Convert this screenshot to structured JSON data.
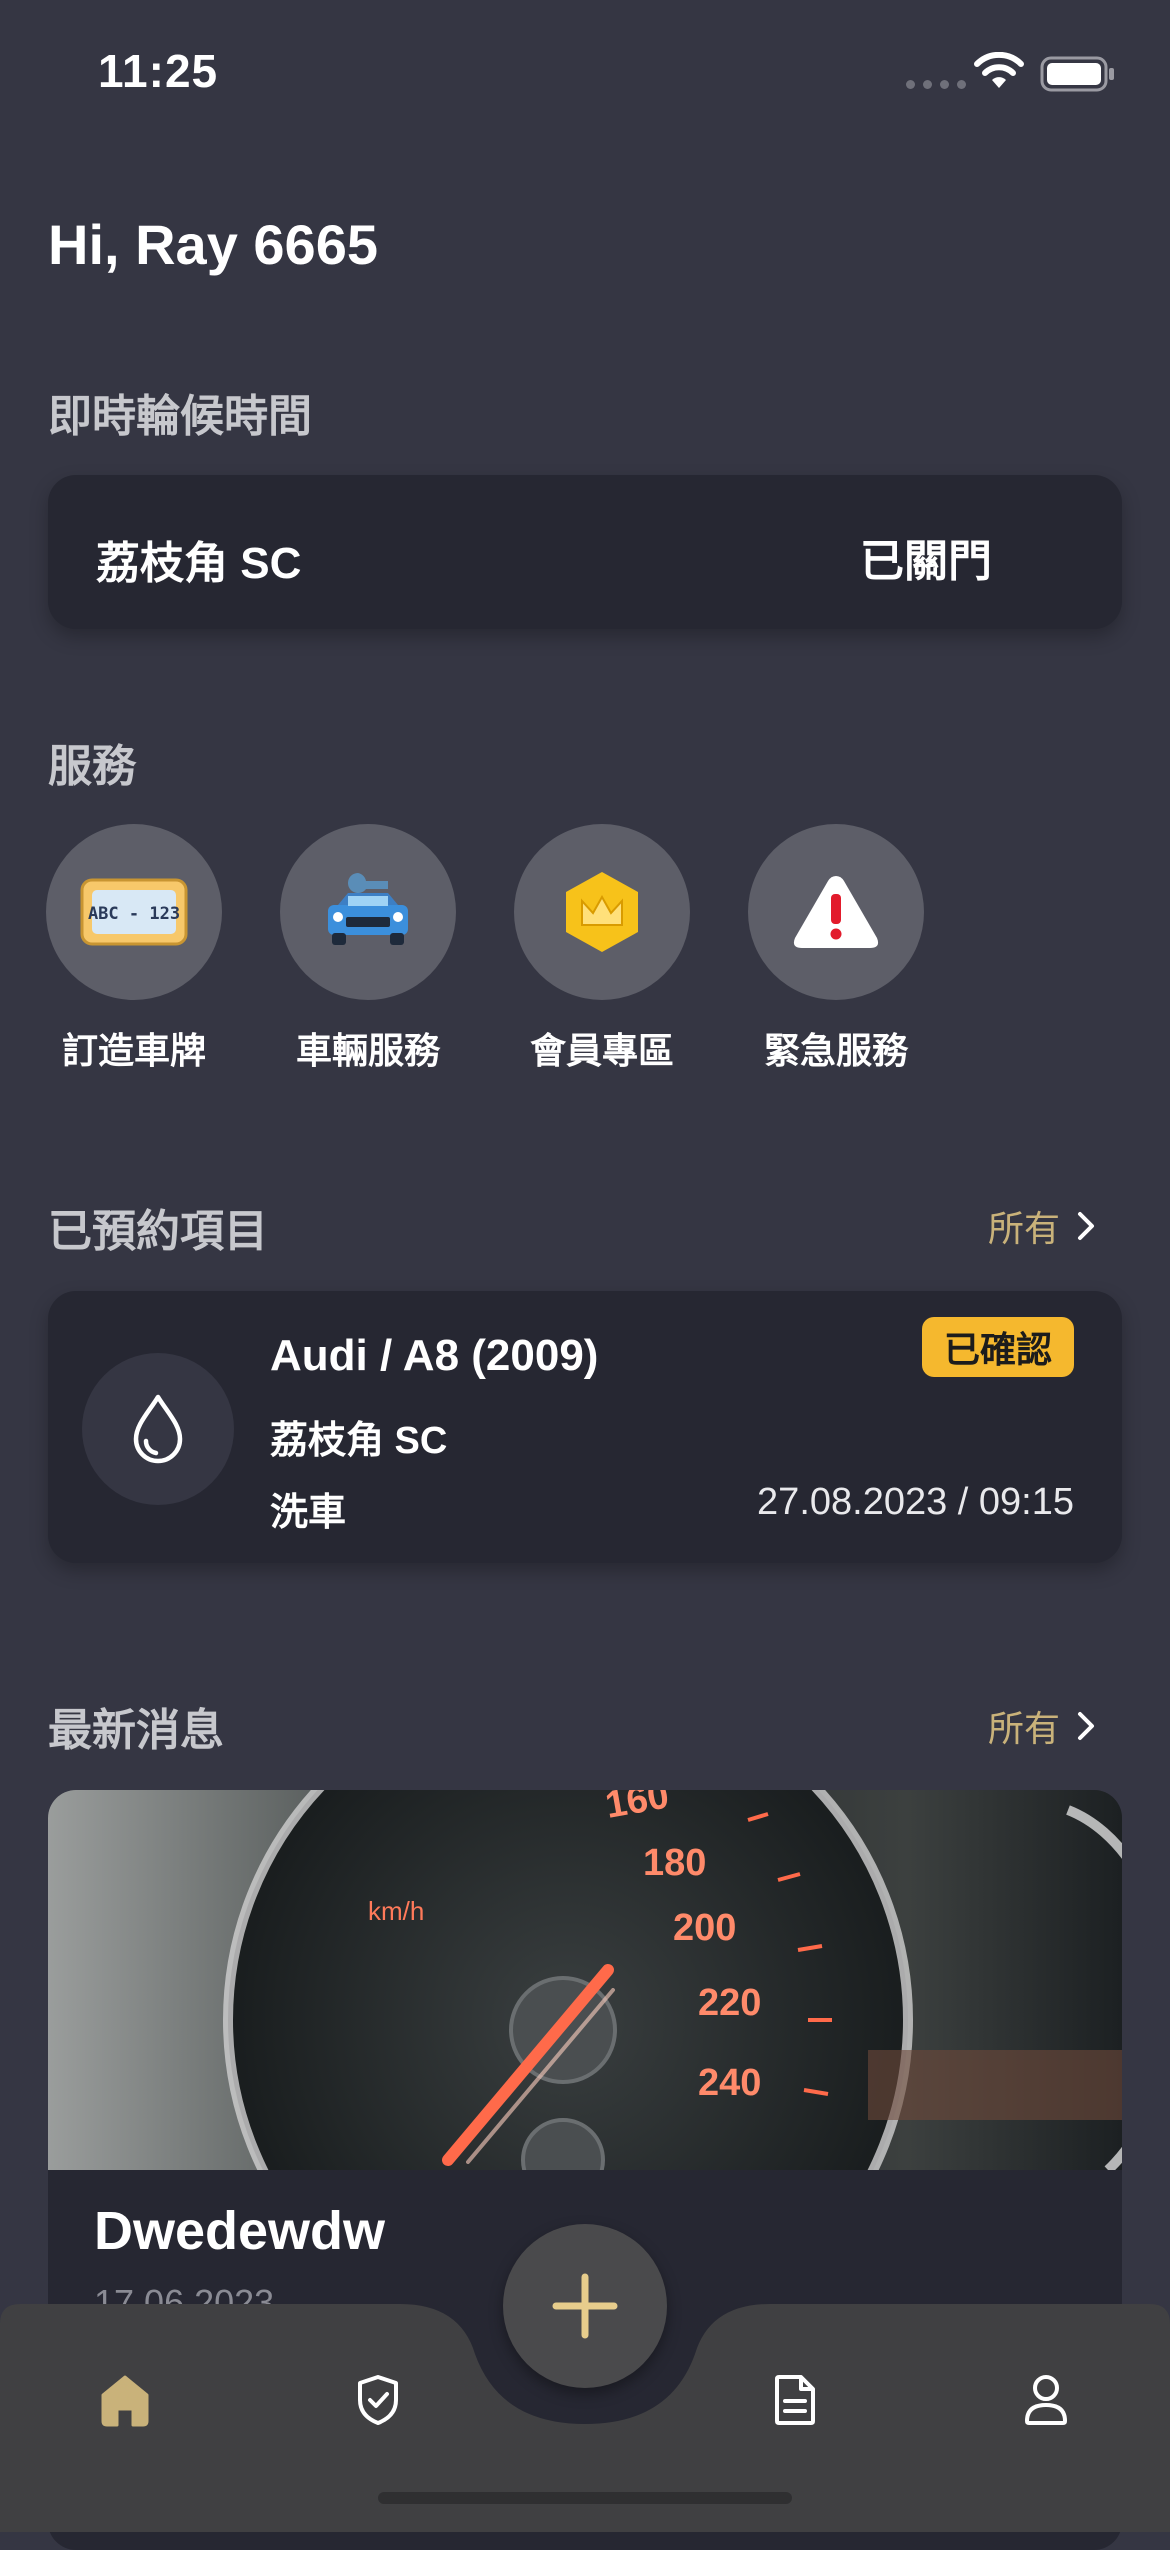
{
  "status_bar": {
    "time": "11:25"
  },
  "greeting": "Hi, Ray 6665",
  "wait_time": {
    "title": "即時輪候時間",
    "branch": "荔枝角 SC",
    "status": "已關門"
  },
  "services": {
    "title": "服務",
    "items": [
      {
        "label": "訂造車牌",
        "icon": "license-plate-icon",
        "plate_text": "ABC - 123"
      },
      {
        "label": "車輛服務",
        "icon": "car-service-icon"
      },
      {
        "label": "會員專區",
        "icon": "crown-icon"
      },
      {
        "label": "緊急服務",
        "icon": "warning-icon"
      }
    ]
  },
  "booked": {
    "title": "已預約項目",
    "all_label": "所有",
    "item": {
      "vehicle": "Audi / A8 (2009)",
      "branch": "荔枝角 SC",
      "service": "洗車",
      "datetime": "27.08.2023 / 09:15",
      "status_badge": "已確認"
    }
  },
  "news": {
    "title": "最新消息",
    "all_label": "所有",
    "item": {
      "headline": "Dwedewdw",
      "date": "17.06.2023",
      "image_label": "km/h",
      "speed_ticks": [
        "160",
        "180",
        "200",
        "220",
        "240"
      ]
    }
  },
  "colors": {
    "background": "#353643",
    "card": "#262732",
    "accent": "#c9b27a",
    "badge": "#f5b82e",
    "nav_bar": "#404042"
  }
}
